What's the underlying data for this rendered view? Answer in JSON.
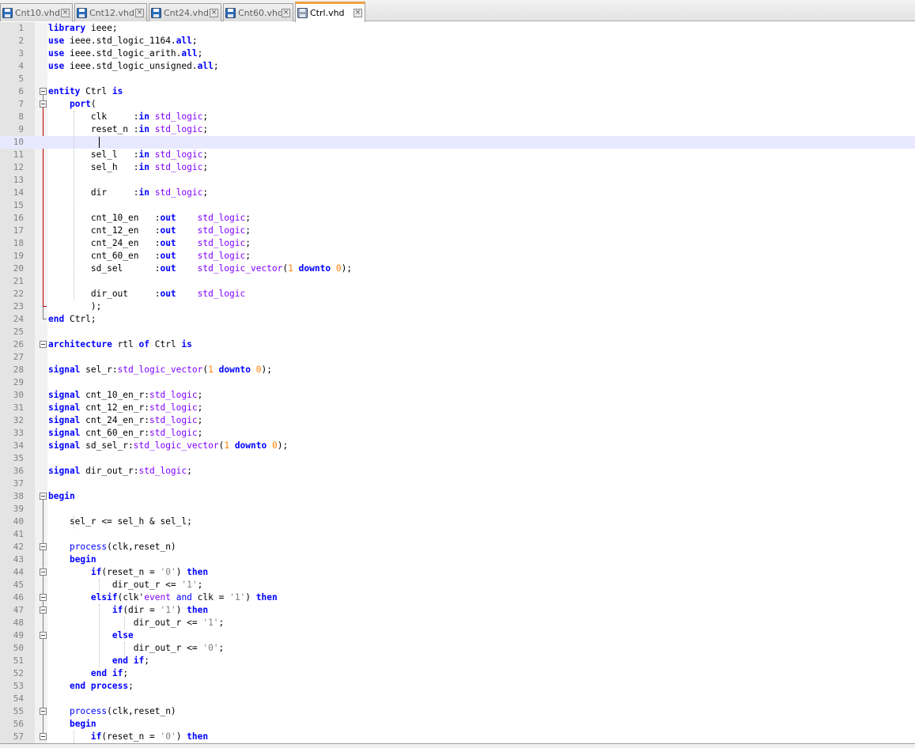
{
  "tabs": [
    {
      "label": "Cnt10.vhd",
      "active": false,
      "icon": "floppy-blue-icon"
    },
    {
      "label": "Cnt12.vhd",
      "active": false,
      "icon": "floppy-blue-icon"
    },
    {
      "label": "Cnt24.vhd",
      "active": false,
      "icon": "floppy-blue-icon"
    },
    {
      "label": "Cnt60.vhd",
      "active": false,
      "icon": "floppy-blue-icon"
    },
    {
      "label": "Ctrl.vhd",
      "active": true,
      "icon": "floppy-gray-icon"
    }
  ],
  "editor": {
    "current_line": 10,
    "language": "VHDL",
    "colors": {
      "keyword": "#0000ff",
      "type": "#8000ff",
      "number": "#ff8000",
      "string": "#808080",
      "current_line_bg": "#e8e8ff",
      "gutter_bg": "#e4e4e4",
      "active_tab_accent": "#f0a040"
    },
    "lines": [
      [
        [
          "library",
          "kw"
        ],
        [
          " ieee;",
          ""
        ]
      ],
      [
        [
          "use",
          "kw"
        ],
        [
          " ieee.std_logic_1164.",
          ""
        ],
        [
          "all",
          "kw"
        ],
        [
          ";",
          ""
        ]
      ],
      [
        [
          "use",
          "kw"
        ],
        [
          " ieee.std_logic_arith.",
          ""
        ],
        [
          "all",
          "kw"
        ],
        [
          ";",
          ""
        ]
      ],
      [
        [
          "use",
          "kw"
        ],
        [
          " ieee.std_logic_unsigned.",
          ""
        ],
        [
          "all",
          "kw"
        ],
        [
          ";",
          ""
        ]
      ],
      [],
      [
        [
          "entity",
          "kw"
        ],
        [
          " Ctrl ",
          ""
        ],
        [
          "is",
          "kw"
        ]
      ],
      [
        [
          "    ",
          ""
        ],
        [
          "port",
          "kw"
        ],
        [
          "(",
          ""
        ]
      ],
      [
        [
          "        clk     :",
          ""
        ],
        [
          "in",
          "kw"
        ],
        [
          " ",
          ""
        ],
        [
          "std_logic",
          "ty"
        ],
        [
          ";",
          ""
        ]
      ],
      [
        [
          "        reset_n :",
          ""
        ],
        [
          "in",
          "kw"
        ],
        [
          " ",
          ""
        ],
        [
          "std_logic",
          "ty"
        ],
        [
          ";",
          ""
        ]
      ],
      [],
      [
        [
          "        sel_l   :",
          ""
        ],
        [
          "in",
          "kw"
        ],
        [
          " ",
          ""
        ],
        [
          "std_logic",
          "ty"
        ],
        [
          ";",
          ""
        ]
      ],
      [
        [
          "        sel_h   :",
          ""
        ],
        [
          "in",
          "kw"
        ],
        [
          " ",
          ""
        ],
        [
          "std_logic",
          "ty"
        ],
        [
          ";",
          ""
        ]
      ],
      [],
      [
        [
          "        dir     :",
          ""
        ],
        [
          "in",
          "kw"
        ],
        [
          " ",
          ""
        ],
        [
          "std_logic",
          "ty"
        ],
        [
          ";",
          ""
        ]
      ],
      [],
      [
        [
          "        cnt_10_en   :",
          ""
        ],
        [
          "out",
          "kw"
        ],
        [
          "    ",
          ""
        ],
        [
          "std_logic",
          "ty"
        ],
        [
          ";",
          ""
        ]
      ],
      [
        [
          "        cnt_12_en   :",
          ""
        ],
        [
          "out",
          "kw"
        ],
        [
          "    ",
          ""
        ],
        [
          "std_logic",
          "ty"
        ],
        [
          ";",
          ""
        ]
      ],
      [
        [
          "        cnt_24_en   :",
          ""
        ],
        [
          "out",
          "kw"
        ],
        [
          "    ",
          ""
        ],
        [
          "std_logic",
          "ty"
        ],
        [
          ";",
          ""
        ]
      ],
      [
        [
          "        cnt_60_en   :",
          ""
        ],
        [
          "out",
          "kw"
        ],
        [
          "    ",
          ""
        ],
        [
          "std_logic",
          "ty"
        ],
        [
          ";",
          ""
        ]
      ],
      [
        [
          "        sd_sel      :",
          ""
        ],
        [
          "out",
          "kw"
        ],
        [
          "    ",
          ""
        ],
        [
          "std_logic_vector",
          "ty"
        ],
        [
          "(",
          ""
        ],
        [
          "1",
          "num"
        ],
        [
          " ",
          ""
        ],
        [
          "downto",
          "kw"
        ],
        [
          " ",
          ""
        ],
        [
          "0",
          "num"
        ],
        [
          ");",
          ""
        ]
      ],
      [],
      [
        [
          "        dir_out     :",
          ""
        ],
        [
          "out",
          "kw"
        ],
        [
          "    ",
          ""
        ],
        [
          "std_logic",
          "ty"
        ]
      ],
      [
        [
          "        );",
          ""
        ]
      ],
      [
        [
          "end",
          "kw"
        ],
        [
          " Ctrl;",
          ""
        ]
      ],
      [],
      [
        [
          "architecture",
          "kw"
        ],
        [
          " rtl ",
          ""
        ],
        [
          "of",
          "kw"
        ],
        [
          " Ctrl ",
          ""
        ],
        [
          "is",
          "kw"
        ]
      ],
      [],
      [
        [
          "signal",
          "kw"
        ],
        [
          " sel_r:",
          ""
        ],
        [
          "std_logic_vector",
          "ty"
        ],
        [
          "(",
          ""
        ],
        [
          "1",
          "num"
        ],
        [
          " ",
          ""
        ],
        [
          "downto",
          "kw"
        ],
        [
          " ",
          ""
        ],
        [
          "0",
          "num"
        ],
        [
          ");",
          ""
        ]
      ],
      [],
      [
        [
          "signal",
          "kw"
        ],
        [
          " cnt_10_en_r:",
          ""
        ],
        [
          "std_logic",
          "ty"
        ],
        [
          ";",
          ""
        ]
      ],
      [
        [
          "signal",
          "kw"
        ],
        [
          " cnt_12_en_r:",
          ""
        ],
        [
          "std_logic",
          "ty"
        ],
        [
          ";",
          ""
        ]
      ],
      [
        [
          "signal",
          "kw"
        ],
        [
          " cnt_24_en_r:",
          ""
        ],
        [
          "std_logic",
          "ty"
        ],
        [
          ";",
          ""
        ]
      ],
      [
        [
          "signal",
          "kw"
        ],
        [
          " cnt_60_en_r:",
          ""
        ],
        [
          "std_logic",
          "ty"
        ],
        [
          ";",
          ""
        ]
      ],
      [
        [
          "signal",
          "kw"
        ],
        [
          " sd_sel_r:",
          ""
        ],
        [
          "std_logic_vector",
          "ty"
        ],
        [
          "(",
          ""
        ],
        [
          "1",
          "num"
        ],
        [
          " ",
          ""
        ],
        [
          "downto",
          "kw"
        ],
        [
          " ",
          ""
        ],
        [
          "0",
          "num"
        ],
        [
          ");",
          ""
        ]
      ],
      [],
      [
        [
          "signal",
          "kw"
        ],
        [
          " dir_out_r:",
          ""
        ],
        [
          "std_logic",
          "ty"
        ],
        [
          ";",
          ""
        ]
      ],
      [],
      [
        [
          "begin",
          "kw"
        ]
      ],
      [],
      [
        [
          "    sel_r <= sel_h & sel_l;",
          ""
        ]
      ],
      [],
      [
        [
          "    ",
          ""
        ],
        [
          "process",
          "fn"
        ],
        [
          "(clk,reset_n)",
          ""
        ]
      ],
      [
        [
          "    ",
          ""
        ],
        [
          "begin",
          "kw"
        ]
      ],
      [
        [
          "        ",
          ""
        ],
        [
          "if",
          "kw"
        ],
        [
          "(reset_n = ",
          ""
        ],
        [
          "'0'",
          "str"
        ],
        [
          ") ",
          ""
        ],
        [
          "then",
          "kw"
        ]
      ],
      [
        [
          "            dir_out_r <= ",
          ""
        ],
        [
          "'1'",
          "str"
        ],
        [
          ";",
          ""
        ]
      ],
      [
        [
          "        ",
          ""
        ],
        [
          "elsif",
          "kw"
        ],
        [
          "(clk'",
          ""
        ],
        [
          "event",
          "ev"
        ],
        [
          " ",
          ""
        ],
        [
          "and",
          "fn"
        ],
        [
          " clk = ",
          ""
        ],
        [
          "'1'",
          "str"
        ],
        [
          ") ",
          ""
        ],
        [
          "then",
          "kw"
        ]
      ],
      [
        [
          "            ",
          ""
        ],
        [
          "if",
          "kw"
        ],
        [
          "(dir = ",
          ""
        ],
        [
          "'1'",
          "str"
        ],
        [
          ") ",
          ""
        ],
        [
          "then",
          "kw"
        ]
      ],
      [
        [
          "                dir_out_r <= ",
          ""
        ],
        [
          "'1'",
          "str"
        ],
        [
          ";",
          ""
        ]
      ],
      [
        [
          "            ",
          ""
        ],
        [
          "else",
          "kw"
        ]
      ],
      [
        [
          "                dir_out_r <= ",
          ""
        ],
        [
          "'0'",
          "str"
        ],
        [
          ";",
          ""
        ]
      ],
      [
        [
          "            ",
          ""
        ],
        [
          "end",
          "kw"
        ],
        [
          " ",
          ""
        ],
        [
          "if",
          "kw"
        ],
        [
          ";",
          ""
        ]
      ],
      [
        [
          "        ",
          ""
        ],
        [
          "end",
          "kw"
        ],
        [
          " ",
          ""
        ],
        [
          "if",
          "kw"
        ],
        [
          ";",
          ""
        ]
      ],
      [
        [
          "    ",
          ""
        ],
        [
          "end",
          "kw"
        ],
        [
          " ",
          ""
        ],
        [
          "process",
          "kw"
        ],
        [
          ";",
          ""
        ]
      ],
      [],
      [
        [
          "    ",
          ""
        ],
        [
          "process",
          "fn"
        ],
        [
          "(clk,reset_n)",
          ""
        ]
      ],
      [
        [
          "    ",
          ""
        ],
        [
          "begin",
          "kw"
        ]
      ],
      [
        [
          "        ",
          ""
        ],
        [
          "if",
          "kw"
        ],
        [
          "(reset_n = ",
          ""
        ],
        [
          "'0'",
          "str"
        ],
        [
          ") ",
          ""
        ],
        [
          "then",
          "kw"
        ]
      ]
    ]
  }
}
